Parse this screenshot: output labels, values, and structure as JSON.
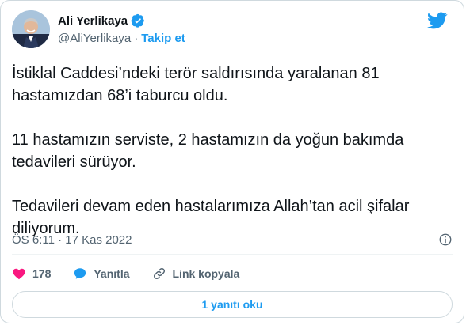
{
  "author": {
    "name": "Ali Yerlikaya",
    "handle": "@AliYerlikaya",
    "separator": "·",
    "follow_label": "Takip et"
  },
  "tweet": {
    "paragraphs": [
      "İstiklal Caddesi’ndeki terör saldırısında yaralanan 81 hastamızdan 68’i taburcu oldu.",
      "11 hastamızın serviste, 2 hastamızın da yoğun bakımda tedavileri sürüyor.",
      "Tedavileri devam eden hastalarımıza Allah’tan acil şifalar diliyorum."
    ],
    "timestamp": "ÖS 6:11 · 17 Kas 2022"
  },
  "actions": {
    "like_count": "178",
    "reply_label": "Yanıtla",
    "copy_link_label": "Link kopyala"
  },
  "read_replies_label": "1 yanıtı oku",
  "icons": {
    "verified": "verified-badge-icon",
    "brand": "twitter-bird-icon",
    "info": "info-icon",
    "like": "heart-icon",
    "reply": "speech-bubble-icon",
    "link": "link-icon"
  },
  "colors": {
    "brand_blue": "#1d9bf0",
    "like_pink": "#f91880",
    "text_primary": "#0f1419",
    "text_secondary": "#536471",
    "border": "#cfd9de"
  }
}
